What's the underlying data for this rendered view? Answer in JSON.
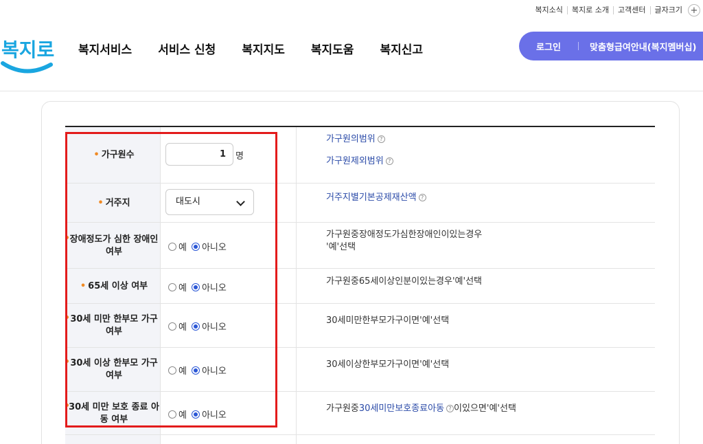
{
  "utility": {
    "items": [
      "복지소식",
      "복지로 소개",
      "고객센터",
      "글자크기"
    ],
    "plus": "+"
  },
  "logo": {
    "text": "복지로"
  },
  "nav": [
    "복지서비스",
    "서비스 신청",
    "복지지도",
    "복지도움",
    "복지신고"
  ],
  "auth": {
    "login": "로그인",
    "member": "맞춤형급여안내(복지멤버십)"
  },
  "form": {
    "household": {
      "label": "가구원수",
      "value": "1",
      "unit": "명"
    },
    "residence": {
      "label": "거주지",
      "selected": "대도시"
    },
    "radio_yes": "예",
    "radio_no": "아니오",
    "disabled": {
      "label": "장애정도가 심한 장애인 여부"
    },
    "over65": {
      "label": "65세 이상 여부"
    },
    "single_under30": {
      "label": "30세 미만 한부모 가구 여부"
    },
    "single_over30": {
      "label": "30세 이상 한부모 가구 여부"
    },
    "protect_under30": {
      "label": "30세 미만 보호 종료 아동 여부"
    }
  },
  "descriptions": {
    "member_scope": "가구원의범위",
    "member_excluded": "가구원제외범위",
    "residence_deduction": "거주지별기본공제재산액",
    "disabled": "가구원중장애정도가심한장애인이있는경우",
    "disabled_2": "'예'선택",
    "over65": "가구원중65세이상인분이있는경우'예'선택",
    "single_under30": "30세미만한부모가구이면'예'선택",
    "single_over30": "30세이상한부모가구이면'예'선택",
    "protect_prefix": "가구원중",
    "protect_link": "30세미만보호종료아동",
    "protect_suffix": "이있으면'예'선택"
  },
  "help_glyph": "?"
}
